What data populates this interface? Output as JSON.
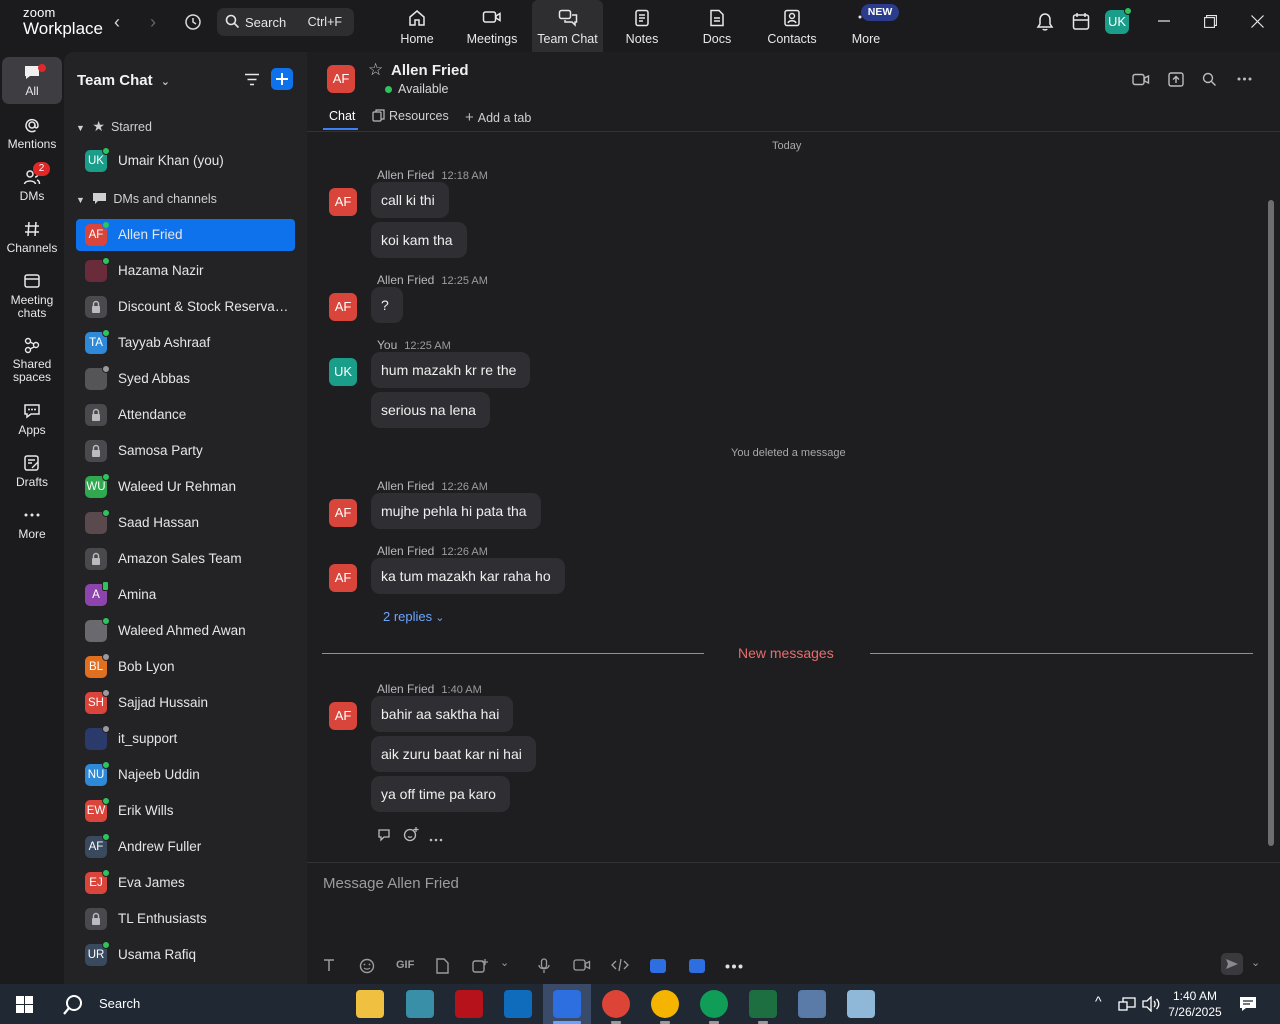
{
  "topbar": {
    "logo_line1": "zoom",
    "logo_line2": "Workplace",
    "search_label": "Search",
    "search_shortcut": "Ctrl+F",
    "tabs": [
      {
        "label": "Home",
        "icon": "home-icon"
      },
      {
        "label": "Meetings",
        "icon": "video-camera-icon"
      },
      {
        "label": "Team Chat",
        "icon": "chat-bubbles-icon"
      },
      {
        "label": "Notes",
        "icon": "notes-icon"
      },
      {
        "label": "Docs",
        "icon": "docs-icon"
      },
      {
        "label": "Contacts",
        "icon": "contacts-icon"
      },
      {
        "label": "More",
        "icon": "more-dots-icon"
      }
    ],
    "new_badge": "NEW",
    "user_initials": "UK"
  },
  "rail": {
    "items": [
      {
        "label": "All"
      },
      {
        "label": "Mentions"
      },
      {
        "label": "DMs",
        "badge": "2"
      },
      {
        "label": "Channels"
      },
      {
        "label": "Meeting chats"
      },
      {
        "label": "Shared spaces"
      },
      {
        "label": "Apps"
      },
      {
        "label": "Drafts"
      },
      {
        "label": "More"
      }
    ]
  },
  "sidebar": {
    "title": "Team Chat",
    "starred_label": "Starred",
    "dms_label": "DMs and channels",
    "starred": [
      {
        "initials": "UK",
        "name": "Umair Khan (you)",
        "color": "#1a9e8a",
        "presence": "online"
      }
    ],
    "items": [
      {
        "initials": "AF",
        "name": "Allen Fried",
        "color": "#d9453a",
        "presence": "online"
      },
      {
        "initials": "",
        "name": "Hazama Nazir",
        "color": "#6a2b3a",
        "presence": "online"
      },
      {
        "initials": "",
        "name": "Discount & Stock Reservati...",
        "color": "#4a4a4e",
        "presence": "lock"
      },
      {
        "initials": "TA",
        "name": "Tayyab Ashraaf",
        "color": "#2e8ad9",
        "presence": "online"
      },
      {
        "initials": "",
        "name": "Syed Abbas",
        "color": "#555558",
        "presence": "away"
      },
      {
        "initials": "",
        "name": "Attendance",
        "color": "#4a4a4e",
        "presence": "lock"
      },
      {
        "initials": "",
        "name": "Samosa Party",
        "color": "#4a4a4e",
        "presence": "lock"
      },
      {
        "initials": "WU",
        "name": "Waleed Ur Rehman",
        "color": "#2fa84f",
        "presence": "online"
      },
      {
        "initials": "",
        "name": "Saad Hassan",
        "color": "#5a4a4e",
        "presence": "online"
      },
      {
        "initials": "",
        "name": "Amazon Sales Team",
        "color": "#4a4a4e",
        "presence": "lock"
      },
      {
        "initials": "A",
        "name": "Amina",
        "color": "#8e44ad",
        "presence": "mobile"
      },
      {
        "initials": "",
        "name": "Waleed Ahmed Awan",
        "color": "#6a6a6e",
        "presence": "online"
      },
      {
        "initials": "BL",
        "name": "Bob Lyon",
        "color": "#e0701f",
        "presence": "away"
      },
      {
        "initials": "SH",
        "name": "Sajjad Hussain",
        "color": "#d9453a",
        "presence": "away"
      },
      {
        "initials": "",
        "name": "it_support",
        "color": "#2a3a6a",
        "presence": "away"
      },
      {
        "initials": "NU",
        "name": "Najeeb Uddin",
        "color": "#2e8ad9",
        "presence": "online"
      },
      {
        "initials": "EW",
        "name": "Erik Wills",
        "color": "#d9453a",
        "presence": "online"
      },
      {
        "initials": "AF",
        "name": "Andrew Fuller",
        "color": "#3a4a5e",
        "presence": "online"
      },
      {
        "initials": "EJ",
        "name": "Eva James",
        "color": "#d9453a",
        "presence": "online"
      },
      {
        "initials": "",
        "name": "TL Enthusiasts",
        "color": "#4a4a4e",
        "presence": "lock"
      },
      {
        "initials": "UR",
        "name": "Usama Rafiq",
        "color": "#3a4a5e",
        "presence": "online"
      }
    ]
  },
  "chat": {
    "contact_initials": "AF",
    "contact_name": "Allen Fried",
    "contact_status": "Available",
    "tabs": [
      "Chat",
      "Resources",
      "Add a tab"
    ],
    "day_label": "Today",
    "deleted_notice": "You deleted a message",
    "new_messages_label": "New messages",
    "replies_label": "2 replies",
    "groups": [
      {
        "initials": "AF",
        "sender": "Allen Fried",
        "time": "12:18 AM",
        "messages": [
          "call ki thi",
          "koi kam tha"
        ]
      },
      {
        "initials": "AF",
        "sender": "Allen Fried",
        "time": "12:25 AM",
        "messages": [
          "?"
        ]
      },
      {
        "initials": "UK",
        "sender": "You",
        "time": "12:25 AM",
        "messages": [
          "hum mazakh kr re the",
          "serious na lena"
        ]
      },
      {
        "initials": "AF",
        "sender": "Allen Fried",
        "time": "12:26 AM",
        "messages": [
          "mujhe pehla hi pata tha"
        ]
      },
      {
        "initials": "AF",
        "sender": "Allen Fried",
        "time": "12:26 AM",
        "messages": [
          "ka tum mazakh kar raha ho"
        ]
      },
      {
        "initials": "AF",
        "sender": "Allen Fried",
        "time": "1:40 AM",
        "messages": [
          "bahir aa saktha hai",
          "aik zuru baat kar ni hai",
          "ya off time pa karo"
        ]
      }
    ],
    "composer_placeholder": "Message Allen Fried",
    "gif_label": "GIF"
  },
  "taskbar": {
    "search_label": "Search",
    "time": "1:40 AM",
    "date": "7/26/2025"
  },
  "colors": {
    "accent": "#0e72ed",
    "online": "#2ec45c",
    "avatar_af": "#d9453a",
    "avatar_uk": "#1a9e8a",
    "new_messages": "#e86c6c"
  }
}
